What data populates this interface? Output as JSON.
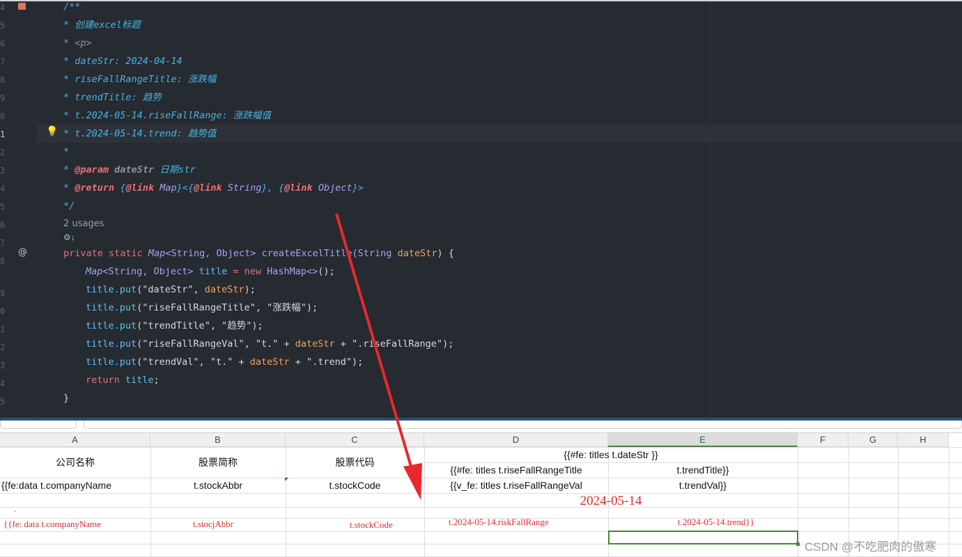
{
  "editor": {
    "line_numbers": [
      "4",
      "5",
      "6",
      "7",
      "8",
      "9",
      "0",
      "1",
      "2",
      "3",
      "4",
      "5",
      "6",
      "7",
      "8",
      "9",
      "0",
      "1",
      "2",
      "3",
      "4",
      "5"
    ],
    "usages": "2 usages",
    "doc": {
      "open": "/**",
      "l1_star": "* ",
      "l1": "创建excel标题",
      "l2": "* <p>",
      "l3": "* dateStr: 2024-04-14",
      "l4": "* riseFallRangeTitle: 涨跌幅",
      "l5": "* trendTitle: 趋势",
      "l6": "* t.2024-05-14.riseFallRange: 涨跌幅值",
      "l7": "* t.2024-05-14.trend: 趋势值",
      "l8": "*",
      "param_tag": "@param",
      "param_name": " dateStr ",
      "param_desc": "日期str",
      "return_tag": "@return",
      "return_rest_1": " {",
      "link": "@link",
      "map": " Map",
      "mid1": "}<{",
      "string": " String",
      "mid2": "}, {",
      "object": " Object",
      "end": "}>",
      "close": "*/"
    },
    "code": {
      "sig": {
        "kw": "private static ",
        "map": "Map",
        "gen": "<String, Object> ",
        "name": "createExcelTitle",
        "p1": "(String ",
        "param": "dateStr",
        "p2": ") {"
      },
      "l1": {
        "map": "Map",
        "gen": "<String, Object> ",
        "id": "title",
        "eq": " = ",
        "kw": "new ",
        "ty": "HashMap<>",
        "end": "();"
      },
      "puts": [
        {
          "a": "(\"dateStr\", ",
          "p": "dateStr",
          "b": ");"
        },
        {
          "a": "(\"riseFallRangeTitle\", \"涨跌幅\");",
          "p": "",
          "b": ""
        },
        {
          "a": "(\"trendTitle\", \"趋势\");",
          "p": "",
          "b": ""
        },
        {
          "a": "(\"riseFallRangeVal\", \"t.\" + ",
          "p": "dateStr",
          "b": " + \".riseFallRange\");"
        },
        {
          "a": "(\"trendVal\", \"t.\" + ",
          "p": "dateStr",
          "b": " + \".trend\");"
        }
      ],
      "put_obj": "title",
      "put_fn": ".put",
      "ret_kw": "return ",
      "ret_id": "title",
      "ret_end": ";",
      "close": "}"
    }
  },
  "sheet": {
    "columns": [
      "A",
      "B",
      "C",
      "D",
      "E",
      "F",
      "G",
      "H"
    ],
    "selected_column": "E",
    "header": {
      "a": "公司名称",
      "b": "股票简称",
      "c": "股票代码",
      "de": "{{#fe: titles  t.dateStr }}",
      "d2": "{{#fe: titles  t.riseFallRangeTitle",
      "e2": "t.trendTitle}}"
    },
    "row3": {
      "a": "{{fe:data  t.companyName",
      "b": "t.stockAbbr",
      "c": "t.stockCode",
      "d": "{{v_fe: titles t.riseFallRangeVal",
      "e": "t.trendVal}}"
    },
    "annotation": {
      "date": "2024-05-14",
      "a": "{{fe: data t.companyName",
      "b": "t.stocjAbbr",
      "c": "t.stockCode",
      "d": "t.2024-05-14.riskFallRange",
      "e": "t.2024-05-14.trend}}",
      "dot": "."
    }
  },
  "watermark": "CSDN @不吃肥肉的傲寒",
  "colors": {
    "arrow": "#e8282c",
    "selection": "#3f8a2c",
    "editor_bg": "#262a31"
  }
}
